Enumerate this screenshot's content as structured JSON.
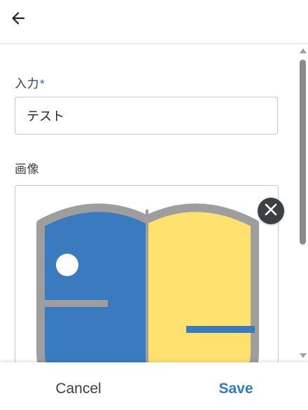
{
  "header": {
    "back_icon": "arrow-left-icon"
  },
  "form": {
    "input": {
      "label": "入力",
      "required_marker": "*",
      "value": "テスト"
    },
    "image": {
      "label": "画像",
      "remove_icon": "close-icon",
      "preview": "shield-logo"
    }
  },
  "footer": {
    "cancel_label": "Cancel",
    "save_label": "Save"
  },
  "colors": {
    "accent": "#2e7bbf",
    "required": "#1a73e8",
    "shield_blue": "#3a7bbf",
    "shield_yellow": "#ffe170",
    "shield_border": "#9e9e9e"
  }
}
